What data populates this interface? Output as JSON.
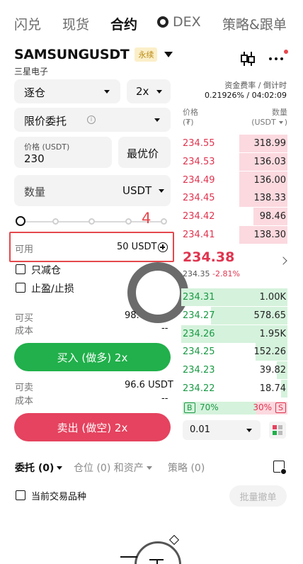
{
  "topnav": {
    "tabs": [
      "闪兑",
      "现货",
      "合约",
      "DEX",
      "策略&跟单"
    ],
    "active_index": 2
  },
  "symbol": {
    "name": "SAMSUNGUSDT",
    "badge": "永续",
    "subname": "三星电子"
  },
  "funding": {
    "label": "资金费率 / 倒计时",
    "value": "0.21926% / 04:02:09"
  },
  "order_form": {
    "margin_mode": "逐仓",
    "leverage": "2x",
    "order_type": "限价委托",
    "price_label": "价格 (USDT)",
    "price_value": "230",
    "best_price": "最优价",
    "qty_label": "数量",
    "qty_unit": "USDT",
    "slider_marker": "4",
    "avail_label": "可用",
    "avail_value": "50 USDT",
    "reduce_only": "只减仓",
    "tp_sl": "止盈/止损",
    "can_buy_label": "可买",
    "can_buy_value": "98.",
    "cost_label": "成本",
    "cost_buy_value": "--",
    "buy_button": "买入 (做多) 2x",
    "can_sell_label": "可卖",
    "can_sell_value": "96.6 USDT",
    "cost_sell_value": "--",
    "sell_button": "卖出 (做空) 2x"
  },
  "orderbook": {
    "price_header": "价格",
    "price_unit": "(₮)",
    "qty_header": "数量",
    "qty_unit": "(USDT",
    "asks": [
      {
        "price": "234.55",
        "qty": "318.99",
        "depth": 0.45
      },
      {
        "price": "234.53",
        "qty": "136.03",
        "depth": 0.45
      },
      {
        "price": "234.49",
        "qty": "136.00",
        "depth": 0.45
      },
      {
        "price": "234.45",
        "qty": "138.33",
        "depth": 0.45
      },
      {
        "price": "234.42",
        "qty": "98.46",
        "depth": 0.32
      },
      {
        "price": "234.41",
        "qty": "138.30",
        "depth": 0.45
      }
    ],
    "last_price": "234.38",
    "mark_price": "234.35",
    "change": "-2.81%",
    "bids": [
      {
        "price": "234.31",
        "qty": "1.00K",
        "depth": 1.0
      },
      {
        "price": "234.27",
        "qty": "578.65",
        "depth": 0.72
      },
      {
        "price": "234.26",
        "qty": "1.95K",
        "depth": 1.0
      },
      {
        "price": "234.25",
        "qty": "152.26",
        "depth": 0.3
      },
      {
        "price": "234.23",
        "qty": "39.82",
        "depth": 0.1
      },
      {
        "price": "234.22",
        "qty": "18.74",
        "depth": 0.06
      }
    ],
    "buy_ratio": "70%",
    "sell_ratio": "30%",
    "buy_tag": "B",
    "sell_tag": "S",
    "precision": "0.01"
  },
  "bottom": {
    "tab_orders": "委托 (0)",
    "tab_positions": "仓位 (0) 和资产",
    "tab_strategy": "策略 (0)",
    "current_symbol_only": "当前交易品种",
    "batch_cancel": "批量撤单"
  },
  "colors": {
    "buy": "#21b04b",
    "sell": "#e5435f",
    "annotation": "#e5484d"
  }
}
